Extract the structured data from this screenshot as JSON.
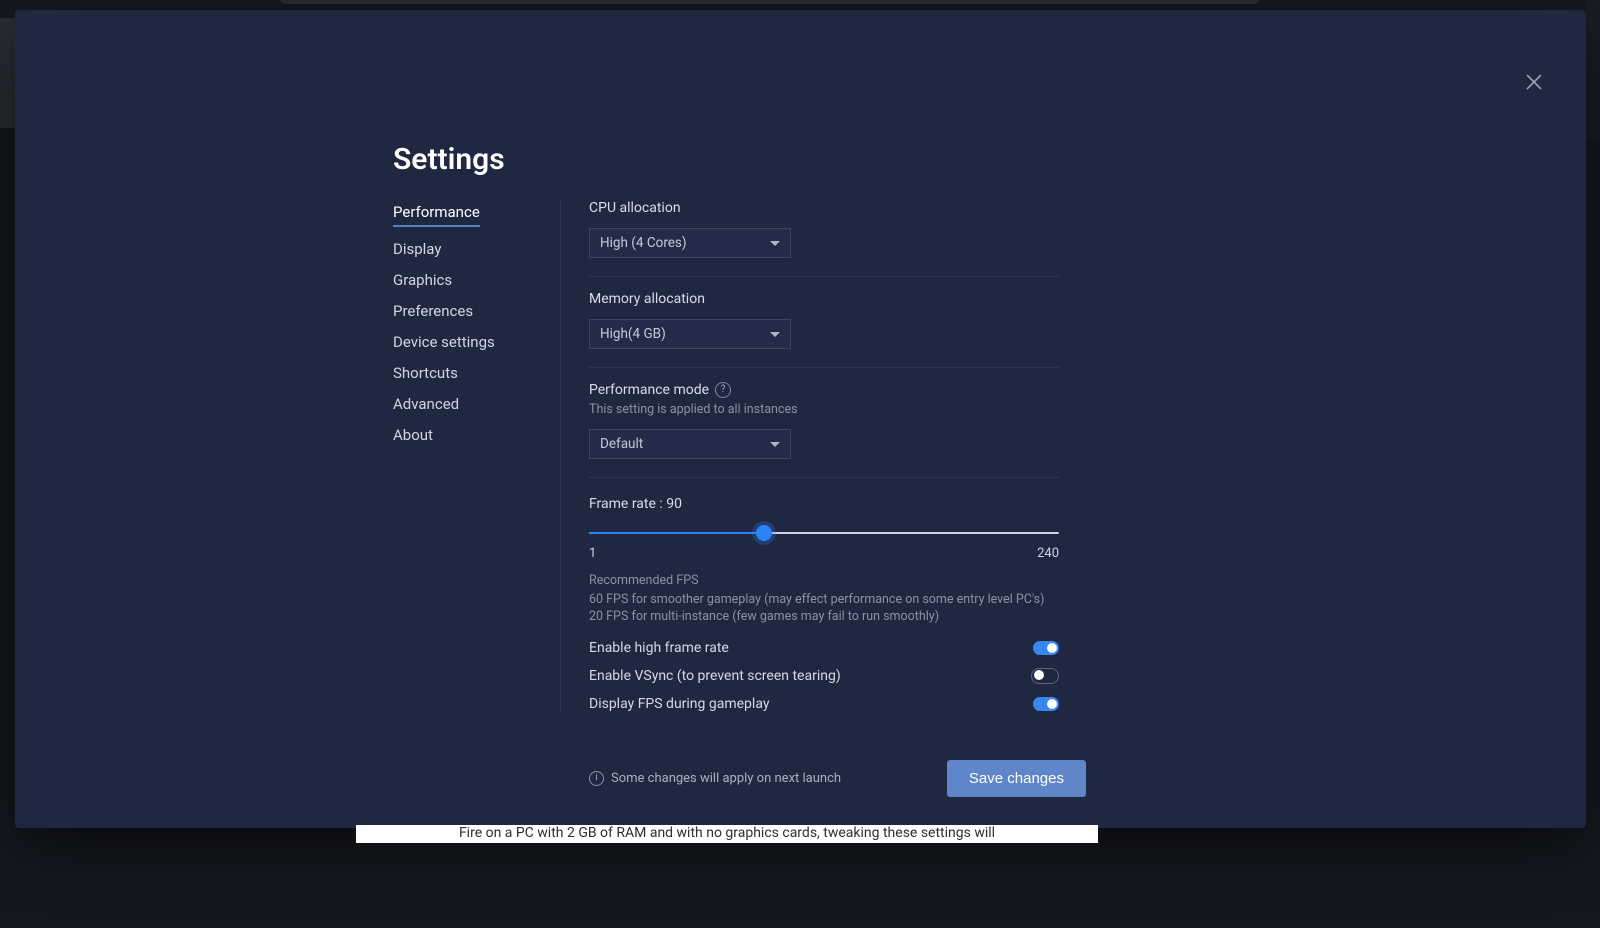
{
  "title": "Settings",
  "sidebar": {
    "items": [
      {
        "label": "Performance",
        "active": true
      },
      {
        "label": "Display"
      },
      {
        "label": "Graphics"
      },
      {
        "label": "Preferences"
      },
      {
        "label": "Device settings"
      },
      {
        "label": "Shortcuts"
      },
      {
        "label": "Advanced"
      },
      {
        "label": "About"
      }
    ]
  },
  "sections": {
    "cpu": {
      "label": "CPU allocation",
      "value": "High (4 Cores)"
    },
    "memory": {
      "label": "Memory allocation",
      "value": "High(4 GB)"
    },
    "perfmode": {
      "label": "Performance mode",
      "note": "This setting is applied to all instances",
      "value": "Default"
    },
    "framerate": {
      "label": "Frame rate : 90",
      "min": "1",
      "max": "240",
      "rec_title": "Recommended FPS",
      "rec_body": "60 FPS for smoother gameplay (may effect performance on some entry level PC's) 20 FPS for multi-instance (few games may fail to run smoothly)"
    },
    "toggles": {
      "high_fps": {
        "label": "Enable high frame rate",
        "on": true
      },
      "vsync": {
        "label": "Enable VSync (to prevent screen tearing)",
        "on": false
      },
      "show_fps": {
        "label": "Display FPS during gameplay",
        "on": true
      }
    }
  },
  "footer": {
    "note": "Some changes will apply on next launch",
    "save": "Save changes"
  },
  "background_strip": "Fire on a PC with 2 GB of RAM and with no graphics cards, tweaking these settings will"
}
